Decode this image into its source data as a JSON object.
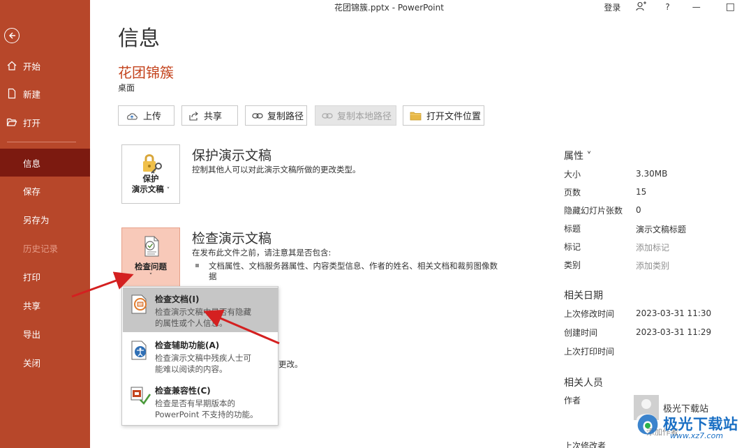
{
  "window": {
    "title": "花团锦簇.pptx - PowerPoint",
    "login": "登录",
    "help": "?",
    "minimize": "—",
    "maximize": "□"
  },
  "sidebar": {
    "items": [
      {
        "label": "开始",
        "icon": "home-icon"
      },
      {
        "label": "新建",
        "icon": "new-file-icon"
      },
      {
        "label": "打开",
        "icon": "folder-open-icon"
      },
      {
        "label": "信息"
      },
      {
        "label": "保存"
      },
      {
        "label": "另存为"
      },
      {
        "label": "历史记录"
      },
      {
        "label": "打印"
      },
      {
        "label": "共享"
      },
      {
        "label": "导出"
      },
      {
        "label": "关闭"
      }
    ]
  },
  "main": {
    "title": "信息",
    "doc_name": "花团锦簇",
    "doc_location": "桌面",
    "buttons": {
      "upload": "上传",
      "share": "共享",
      "copy_path": "复制路径",
      "copy_local_path": "复制本地路径",
      "open_location": "打开文件位置"
    },
    "protect": {
      "card_line1": "保护",
      "card_line2": "演示文稿",
      "title": "保护演示文稿",
      "desc": "控制其他人可以对此演示文稿所做的更改类型。"
    },
    "inspect": {
      "card_label": "检查问题",
      "title": "检查演示文稿",
      "desc": "在发布此文件之前，请注意其是否包含:",
      "bullet_line1": "文档属性、文档服务器属性、内容类型信息、作者的姓名、相关文档和裁剪图像数",
      "bullet_line2": "据",
      "obscured_tail": "更改。"
    }
  },
  "dropdown": {
    "items": [
      {
        "title": "检查文档(I)",
        "desc_line1": "检查演示文稿中是否有隐藏",
        "desc_line2": "的属性或个人信息。"
      },
      {
        "title": "检查辅助功能(A)",
        "desc_line1": "检查演示文稿中残疾人士可",
        "desc_line2": "能难以阅读的内容。"
      },
      {
        "title": "检查兼容性(C)",
        "desc_line1": "检查是否有早期版本的",
        "desc_line2": "PowerPoint 不支持的功能。"
      }
    ]
  },
  "properties": {
    "heading": "属性 ˅",
    "rows": [
      {
        "label": "大小",
        "value": "3.30MB"
      },
      {
        "label": "页数",
        "value": "15"
      },
      {
        "label": "隐藏幻灯片张数",
        "value": "0"
      },
      {
        "label": "标题",
        "value": "演示文稿标题"
      },
      {
        "label": "标记",
        "value": "添加标记"
      },
      {
        "label": "类别",
        "value": "添加类别"
      }
    ],
    "dates_heading": "相关日期",
    "dates": [
      {
        "label": "上次修改时间",
        "value": "2023-03-31 11:30"
      },
      {
        "label": "创建时间",
        "value": "2023-03-31 11:29"
      },
      {
        "label": "上次打印时间",
        "value": ""
      }
    ],
    "people_heading": "相关人员",
    "author_label": "作者",
    "author_name": "极光下载站",
    "add_author": "添加作者",
    "last_modified_by": "上次修改者"
  },
  "watermark": {
    "text": "极光下载站",
    "url": "www.xz7.com"
  },
  "colors": {
    "sidebar": "#b7472a",
    "sidebar_active": "#7c1a10",
    "accent": "#c4441e",
    "annotation_arrow": "#d42020"
  }
}
